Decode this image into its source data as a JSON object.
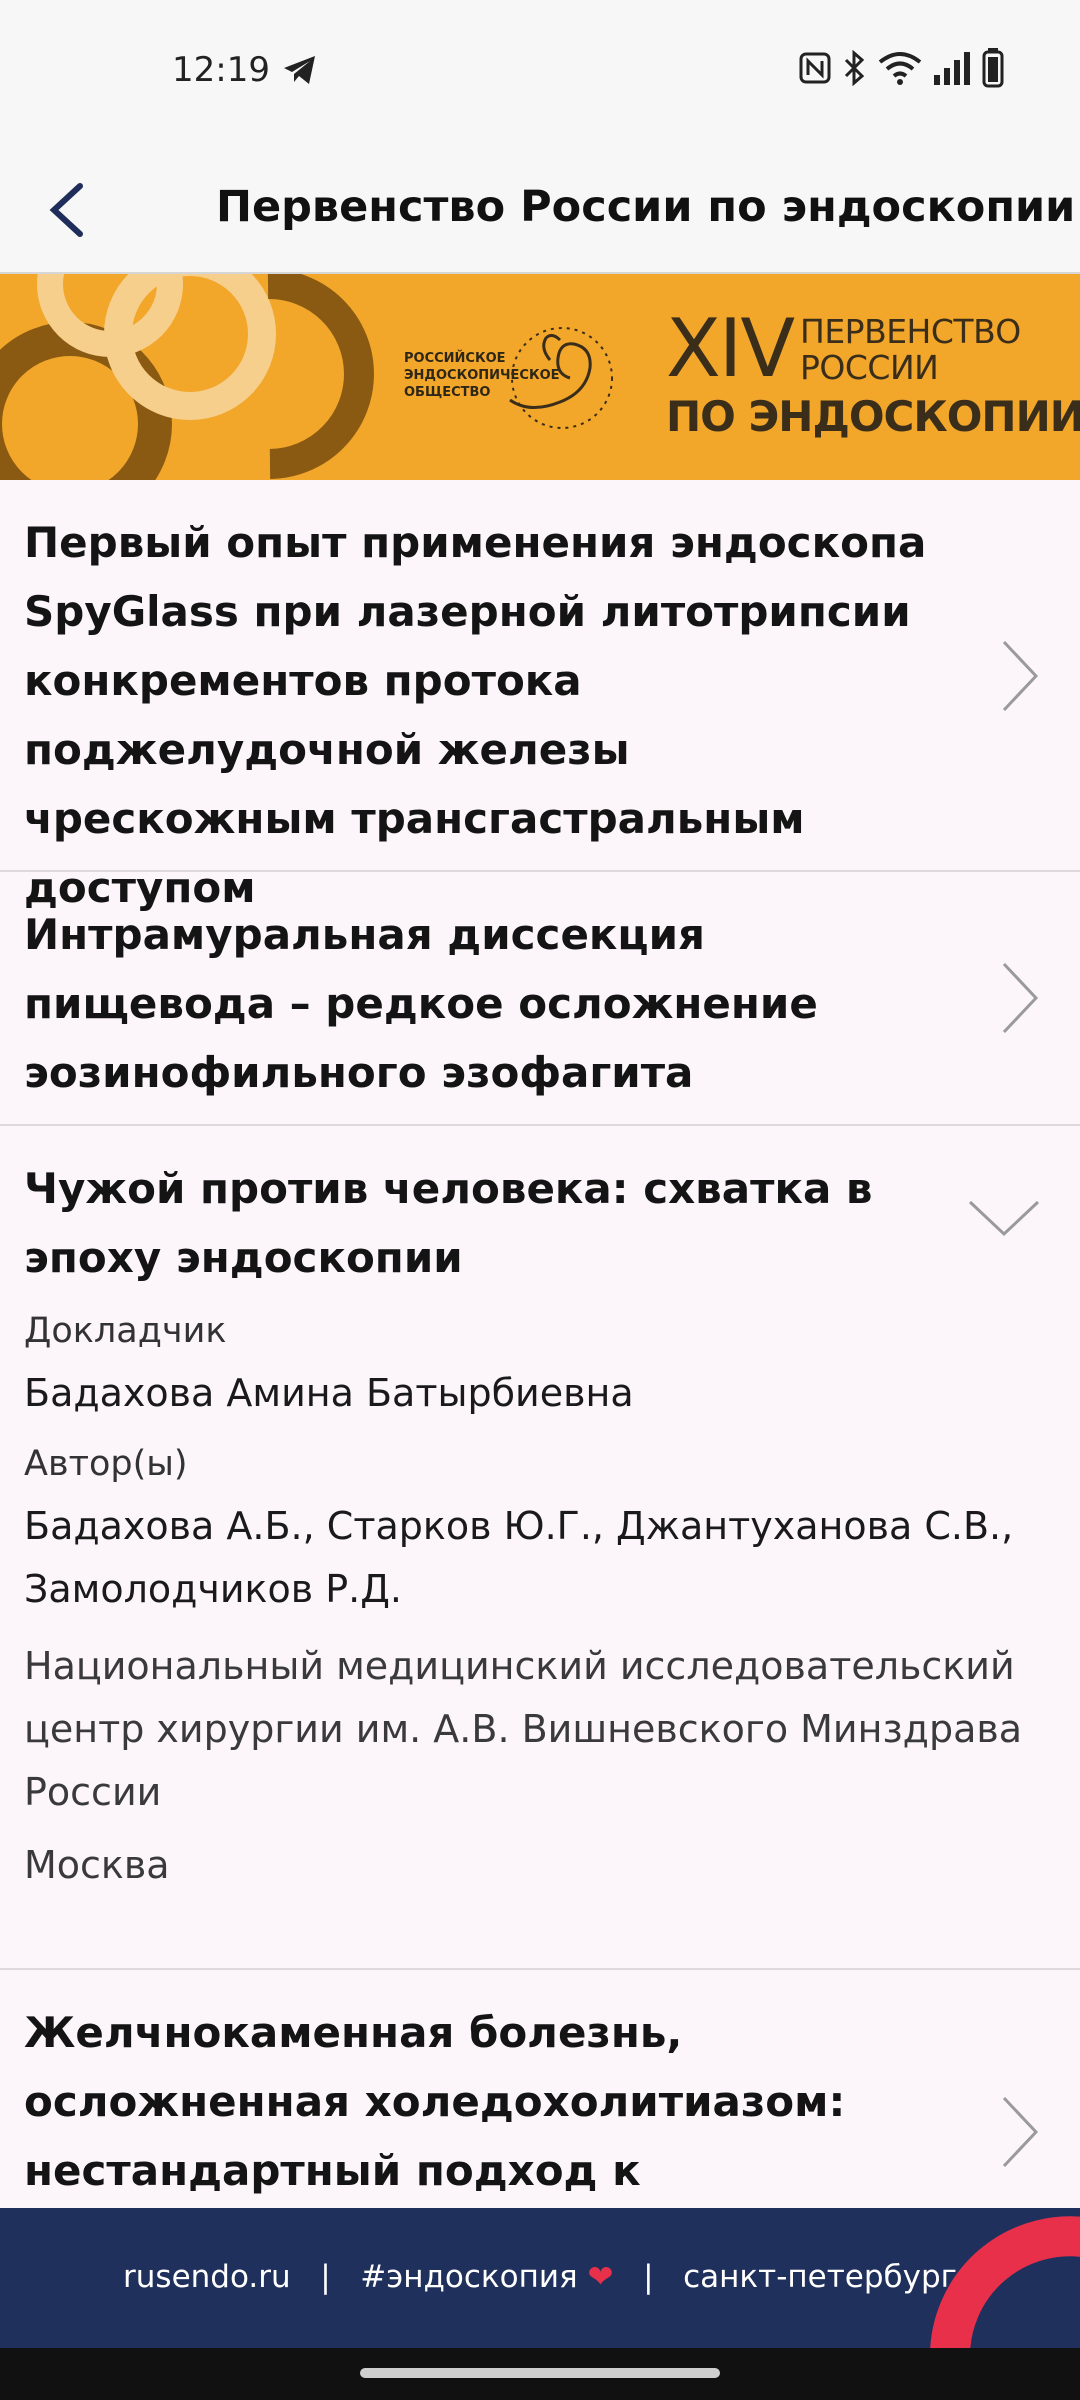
{
  "status_bar": {
    "time": "12:19",
    "icons": [
      "telegram-icon",
      "nfc-icon",
      "bluetooth-icon",
      "wifi-icon",
      "signal-icon",
      "battery-icon"
    ]
  },
  "app_bar": {
    "title": "Первенство России по эндоскопии"
  },
  "banner": {
    "org_line1": "РОССИЙСКОЕ",
    "org_line2": "ЭНДОСКОПИЧЕСКОЕ",
    "org_line3": "ОБЩЕСТВО",
    "roman": "XIV",
    "line1": "ПЕРВЕНСТВО",
    "line2": "РОССИИ",
    "line3": "ПО ЭНДОСКОПИИ",
    "colors": {
      "background": "#f2a72b",
      "dark_ring": "#8a5a12",
      "light_ring": "#f6cf8c"
    }
  },
  "talks": [
    {
      "title": "Первый опыт применения эндоскопа SpyGlass при лазерной литотрипсии конкрементов протока поджелудочной железы чрескожным трансгастральным доступом",
      "expanded": false
    },
    {
      "title": "Интрамуральная диссекция пищевода – редкое осложнение эозинофильного эзофагита",
      "expanded": false
    },
    {
      "title": "Чужой против человека: схватка в эпоху эндоскопии",
      "expanded": true,
      "speaker_label": "Докладчик",
      "speaker": "Бадахова Амина Батырбиевна",
      "authors_label": "Автор(ы)",
      "authors": "Бадахова А.Б., Старков Ю.Г., Джантуханова С.В., Замолодчиков Р.Д.",
      "institution": "Национальный медицинский исследовательский центр хирургии им. А.В. Вишневского Минздрава России",
      "city": "Москва"
    },
    {
      "title": "Желчнокаменная болезнь, осложненная холедохолитиазом: нестандартный подход к стандартной",
      "expanded": false
    }
  ],
  "footer": {
    "site": "rusendo.ru",
    "sep1": "|",
    "hashtag": "#эндоскопия",
    "heart": "❤",
    "sep2": "|",
    "city": "санкт-петербург",
    "colors": {
      "background": "#20305c",
      "accent": "#e8304a"
    }
  }
}
